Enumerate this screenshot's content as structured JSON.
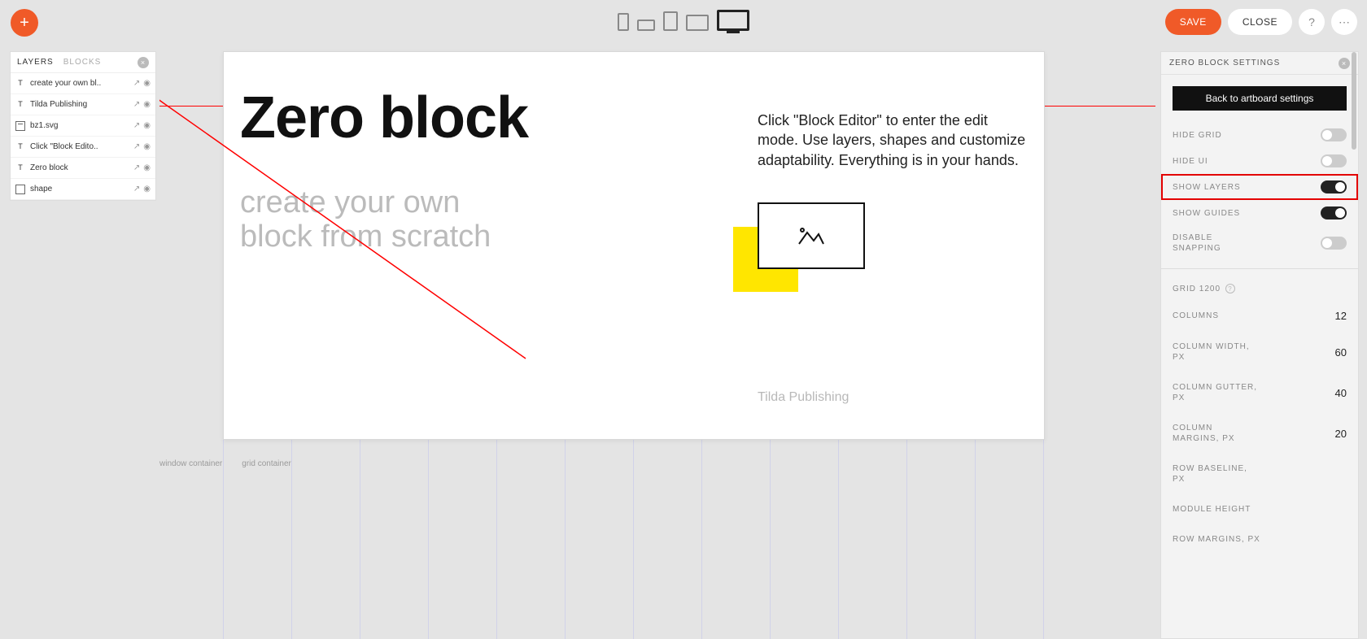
{
  "topbar": {
    "save": "SAVE",
    "close": "CLOSE"
  },
  "layers_panel": {
    "tab_layers": "LAYERS",
    "tab_blocks": "BLOCKS",
    "items": [
      {
        "type": "t",
        "name": "create your own bl.."
      },
      {
        "type": "t",
        "name": "Tilda Publishing"
      },
      {
        "type": "img",
        "name": "bz1.svg"
      },
      {
        "type": "t",
        "name": "Click \"Block Edito.."
      },
      {
        "type": "t",
        "name": "Zero block"
      },
      {
        "type": "shape",
        "name": "shape"
      }
    ]
  },
  "artboard": {
    "title": "Zero block",
    "subtitle_line1": "create your own",
    "subtitle_line2": "block from scratch",
    "description": "Click \"Block Editor\" to enter the edit mode. Use layers, shapes and customize adaptability. Everything is in your hands.",
    "footer": "Tilda Publishing"
  },
  "canvas_labels": {
    "window_container": "window container",
    "grid_container": "grid container"
  },
  "right_panel": {
    "title": "ZERO BLOCK SETTINGS",
    "back_btn": "Back to artboard settings",
    "toggles": {
      "hide_grid": {
        "label": "HIDE GRID",
        "on": false
      },
      "hide_ui": {
        "label": "HIDE UI",
        "on": false
      },
      "show_layers": {
        "label": "SHOW LAYERS",
        "on": true
      },
      "show_guides": {
        "label": "SHOW GUIDES",
        "on": true
      },
      "disable_snapping": {
        "label": "DISABLE SNAPPING",
        "on": false
      }
    },
    "grid_section_label": "GRID 1200",
    "fields": {
      "columns": {
        "label": "COLUMNS",
        "value": "12"
      },
      "column_width": {
        "label": "COLUMN WIDTH, PX",
        "value": "60"
      },
      "column_gutter": {
        "label": "COLUMN GUTTER, PX",
        "value": "40"
      },
      "column_margins": {
        "label": "COLUMN MARGINS, PX",
        "value": "20"
      },
      "row_baseline": {
        "label": "ROW BASELINE, PX",
        "value": ""
      },
      "module_height": {
        "label": "MODULE HEIGHT",
        "value": ""
      },
      "row_margins": {
        "label": "ROW MARGINS, PX",
        "value": ""
      }
    }
  }
}
